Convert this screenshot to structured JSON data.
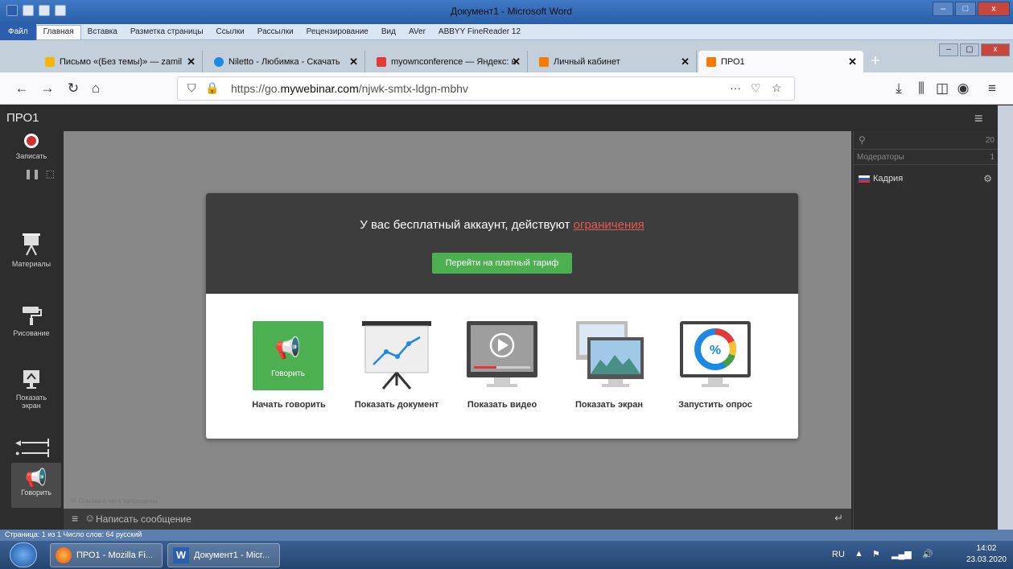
{
  "word": {
    "title": "Документ1 - Microsoft Word",
    "ribbon_tabs": [
      "Файл",
      "Главная",
      "Вставка",
      "Разметка страницы",
      "Ссылки",
      "Рассылки",
      "Рецензирование",
      "Вид",
      "AVer",
      "ABBYY FineReader 12"
    ],
    "status": "Страница: 1 из 1    Число слов: 64    русский"
  },
  "browser": {
    "tabs": [
      {
        "label": "Письмо «(Без темы)» — zamil",
        "fav_color": "#f2b705"
      },
      {
        "label": "Niletto - Любимка - Скачать",
        "fav_color": "#1e88e5"
      },
      {
        "label": "myownconference — Яндекс: н",
        "fav_color": "#e53935"
      },
      {
        "label": "Личный кабинет",
        "fav_color": "#f57c00"
      },
      {
        "label": "ПРО1",
        "fav_color": "#f57c00"
      }
    ],
    "url_host": "https://go.",
    "url_domain": "mywebinar.com",
    "url_path": "/njwk-smtx-ldgn-mbhv",
    "url_more": "···"
  },
  "app": {
    "title": "ПРО1",
    "sidebar": {
      "record_label": "Записать",
      "materials_label": "Материалы",
      "drawing_label": "Рисование",
      "screen_label": "Показать экран",
      "speak_label": "Говорить"
    },
    "right_panel": {
      "count": "20",
      "moderators_label": "Модераторы",
      "moderators_count": "1",
      "user_name": "Кадрия"
    },
    "chat": {
      "note": "Ссылки в чате запрещены",
      "placeholder": "Написать сообщение"
    }
  },
  "modal": {
    "heading": "У вас бесплатный аккаунт, действуют ",
    "heading_link": "ограничения",
    "upgrade_button": "Перейти на платный тариф",
    "speak_tile_label": "Говорить",
    "options": [
      "Начать говорить",
      "Показать документ",
      "Показать видео",
      "Показать экран",
      "Запустить опрос"
    ]
  },
  "taskbar": {
    "firefox_label": "ПРО1 - Mozilla Fi...",
    "word_label": "Документ1 - Micr...",
    "lang": "RU",
    "time": "14:02",
    "date": "23.03.2020"
  },
  "colors": {
    "accent_green": "#4caf50",
    "link_red": "#e25a4e",
    "dark_bg": "#2d2d2d",
    "stage_bg": "#888888"
  }
}
